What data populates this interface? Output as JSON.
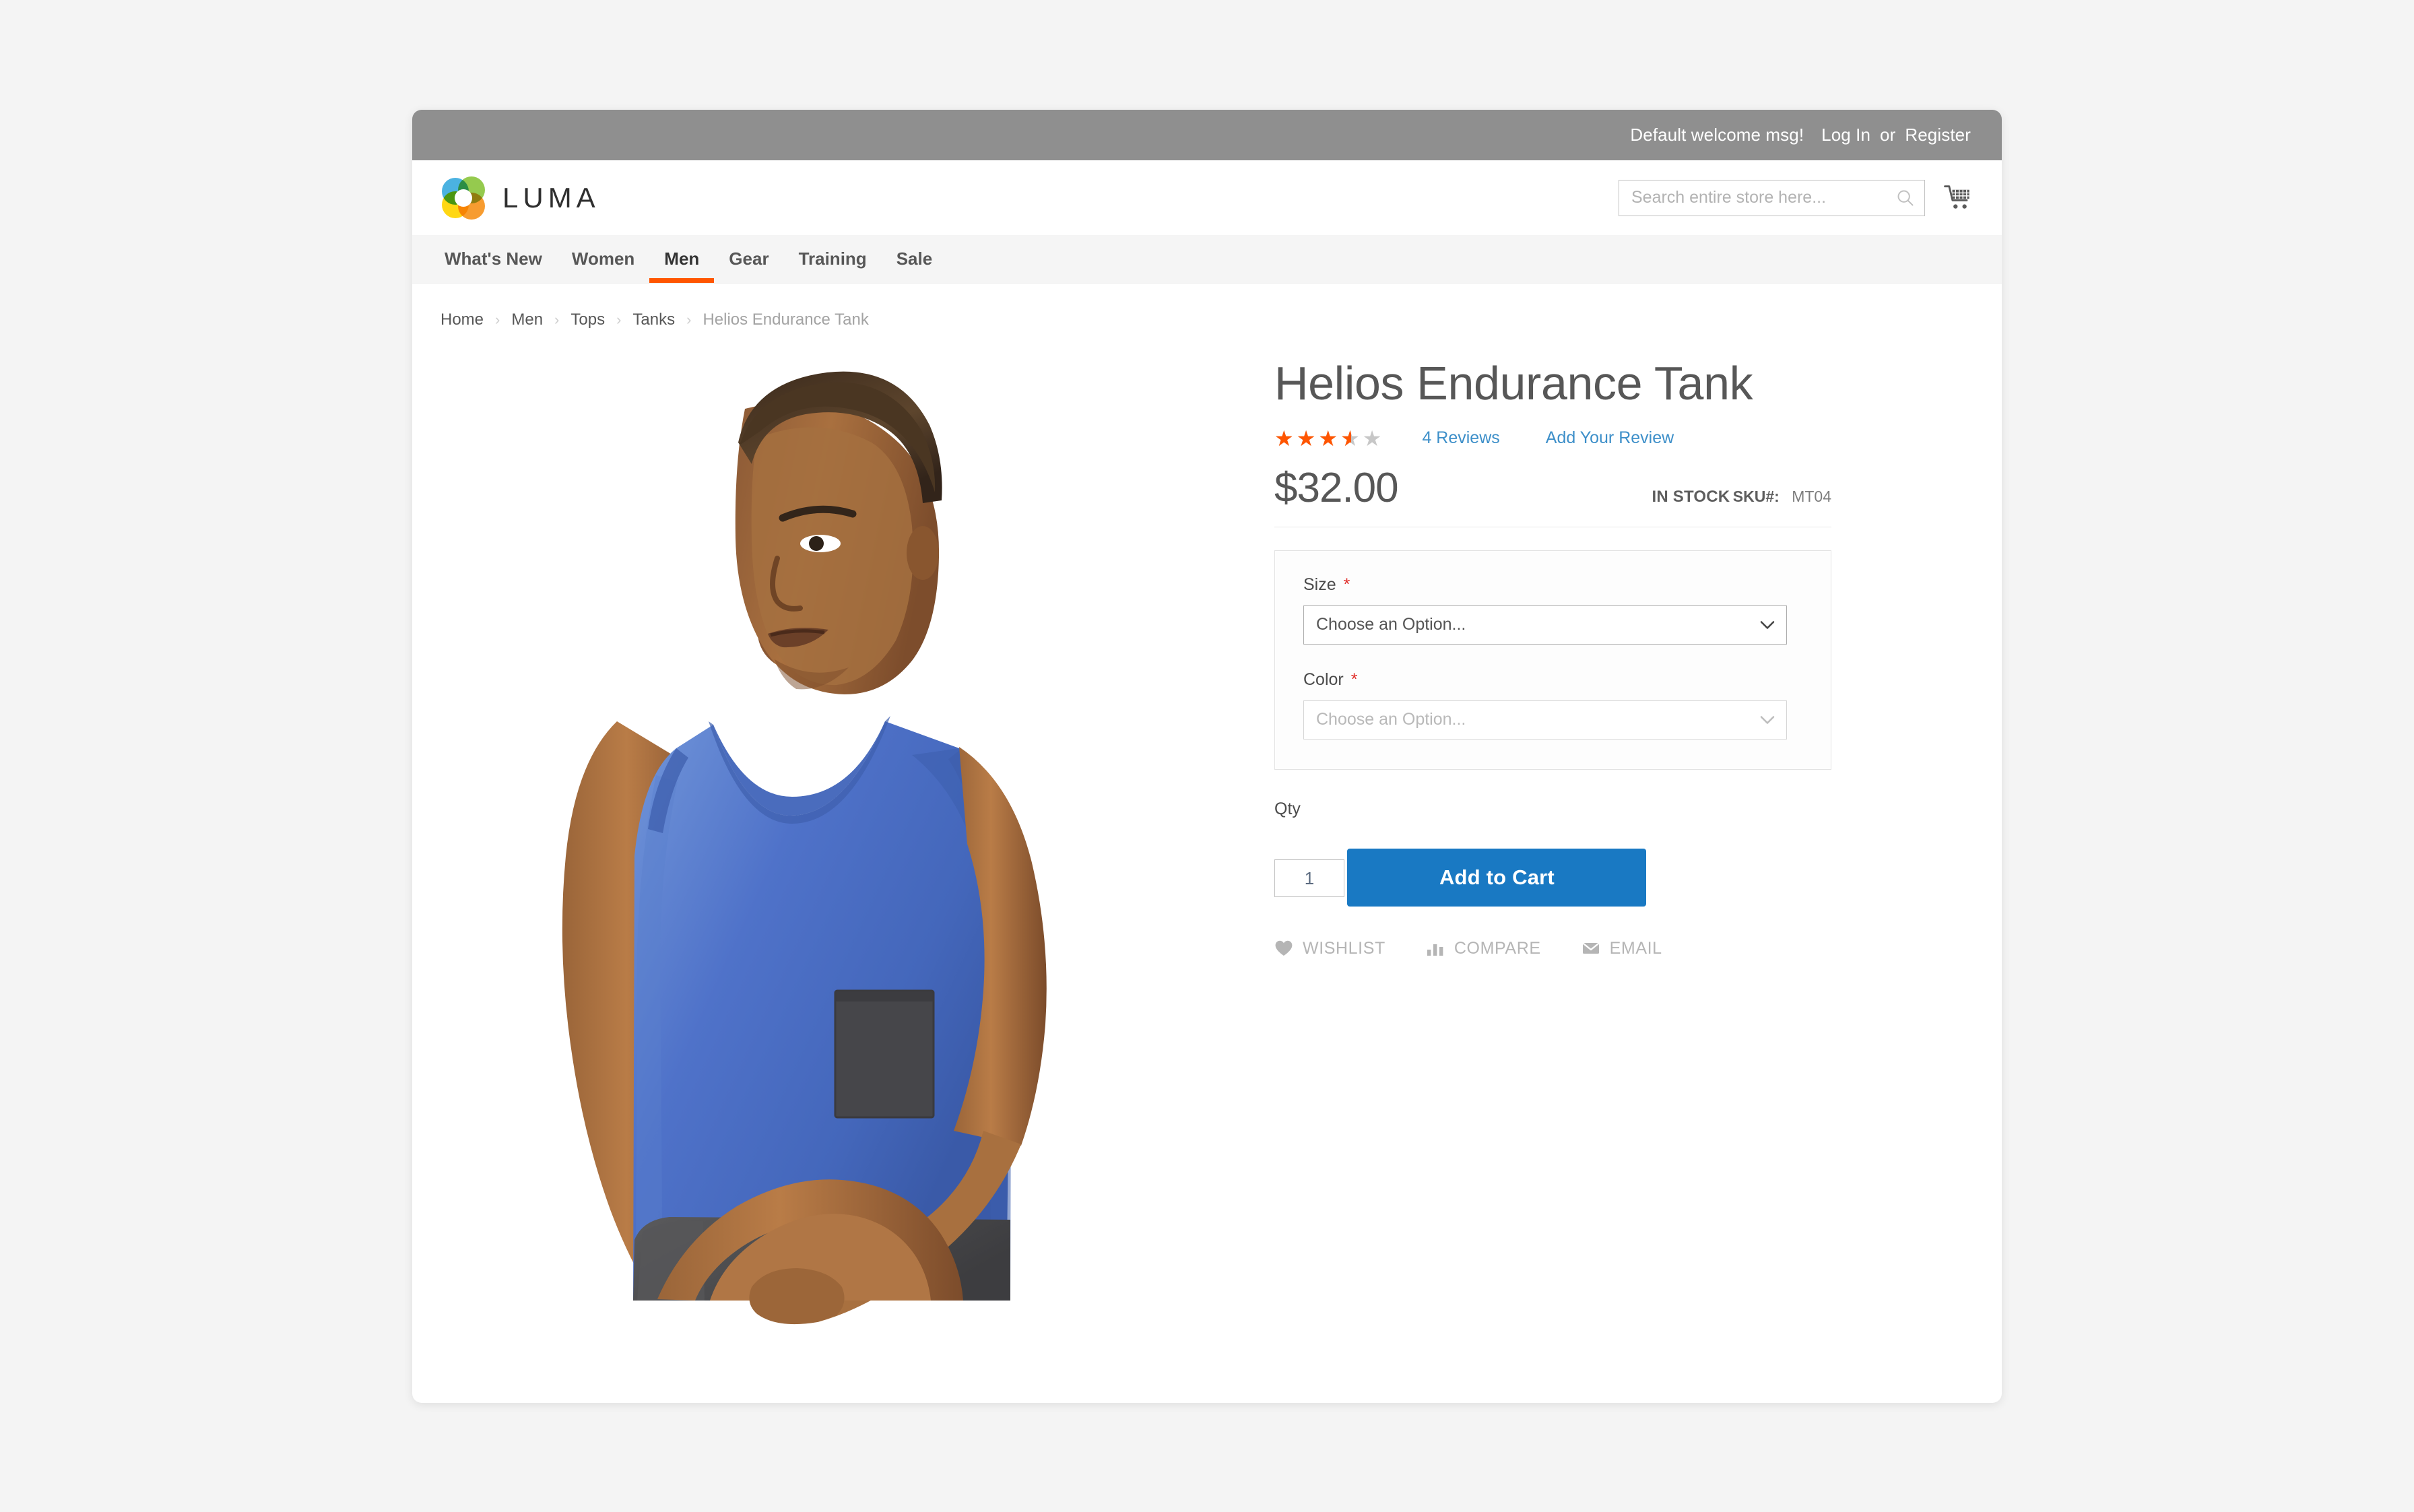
{
  "top_panel": {
    "welcome_message": "Default welcome msg!",
    "login_label": "Log In",
    "or_label": "or",
    "register_label": "Register"
  },
  "header": {
    "logo_text": "LUMA",
    "search": {
      "placeholder": "Search entire store here...",
      "value": ""
    },
    "cart_icon": "shopping-cart-icon"
  },
  "nav": {
    "items": [
      {
        "label": "What's New",
        "active": false
      },
      {
        "label": "Women",
        "active": false
      },
      {
        "label": "Men",
        "active": true
      },
      {
        "label": "Gear",
        "active": false
      },
      {
        "label": "Training",
        "active": false
      },
      {
        "label": "Sale",
        "active": false
      }
    ],
    "active_underline_color": "#ff5501"
  },
  "breadcrumbs": {
    "separator": "›",
    "items": [
      {
        "label": "Home",
        "current": false
      },
      {
        "label": "Men",
        "current": false
      },
      {
        "label": "Tops",
        "current": false
      },
      {
        "label": "Tanks",
        "current": false
      },
      {
        "label": "Helios Endurance Tank",
        "current": true
      }
    ]
  },
  "product": {
    "title": "Helios Endurance Tank",
    "rating": {
      "stars_filled": 3.5,
      "stars_total": 5,
      "filled_color": "#ff5501",
      "empty_color": "#c7c7c7",
      "reviews_link": "4 Reviews",
      "add_review_link": "Add Your Review"
    },
    "price": "$32.00",
    "availability": "IN STOCK",
    "sku_label": "SKU#:",
    "sku_value": "MT04",
    "options": [
      {
        "label": "Size",
        "required": true,
        "selected_value": "Choose an Option...",
        "state": "active"
      },
      {
        "label": "Color",
        "required": true,
        "selected_value": "Choose an Option...",
        "state": "muted"
      }
    ],
    "qty_label": "Qty",
    "qty_value": "1",
    "add_to_cart_label": "Add to Cart",
    "add_to_cart_color": "#1979c3",
    "action_links": [
      {
        "label": "WISHLIST",
        "icon": "heart-icon"
      },
      {
        "label": "COMPARE",
        "icon": "bar-chart-icon"
      },
      {
        "label": "EMAIL",
        "icon": "envelope-icon"
      }
    ],
    "image_alt": "Man wearing blue Helios Endurance Tank with dark gray chest pocket"
  }
}
